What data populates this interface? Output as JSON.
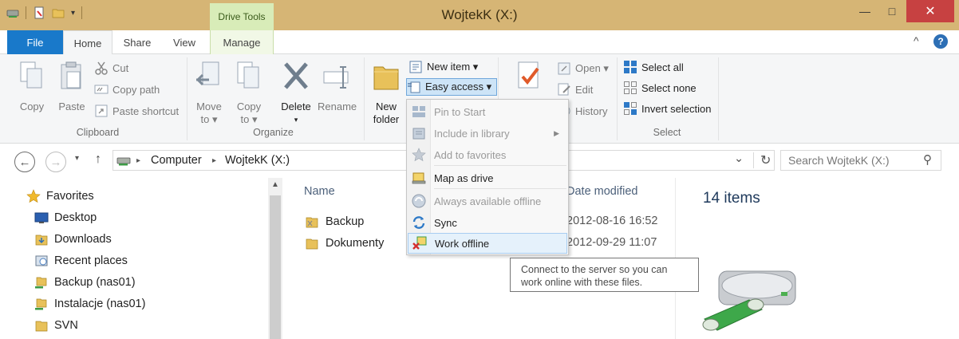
{
  "window": {
    "title": "WojtekK (X:)",
    "context_tab_title": "Drive Tools",
    "controls": {
      "minimize": "—",
      "maximize": "□",
      "close": "✕"
    }
  },
  "tabs": {
    "file": "File",
    "home": "Home",
    "share": "Share",
    "view": "View",
    "manage": "Manage",
    "collapse_glyph": "^",
    "help_glyph": "?"
  },
  "ribbon": {
    "clipboard": {
      "label": "Clipboard",
      "copy": "Copy",
      "paste": "Paste",
      "cut": "Cut",
      "copy_path": "Copy path",
      "paste_shortcut": "Paste shortcut"
    },
    "organize": {
      "label": "Organize",
      "move_to": "Move to",
      "copy_to": "Copy to",
      "delete": "Delete",
      "rename": "Rename",
      "move_to_line1": "Move",
      "move_to_line2": "to ▾",
      "copy_to_line1": "Copy",
      "copy_to_line2": "to ▾",
      "delete_arrow": "▾"
    },
    "new": {
      "new_folder_line1": "New",
      "new_folder_line2": "folder",
      "new_item": "New item ▾",
      "easy_access": "Easy access ▾"
    },
    "open": {
      "open": "Open ▾",
      "edit": "Edit",
      "history": "History"
    },
    "select": {
      "label": "Select",
      "select_all": "Select all",
      "select_none": "Select none",
      "invert_selection": "Invert selection"
    }
  },
  "address": {
    "back_glyph": "←",
    "forward_glyph": "→",
    "recent_glyph": "▾",
    "up_glyph": "↑",
    "crumb_sep": "▸",
    "crumbs": [
      "Computer",
      "WojtekK (X:)"
    ],
    "dropdown_glyph": "⌄",
    "refresh_glyph": "↻",
    "search_placeholder": "Search WojtekK (X:)",
    "search_glyph": "⚲"
  },
  "nav_pane": {
    "favorites": "Favorites",
    "items": [
      "Desktop",
      "Downloads",
      "Recent places",
      "Backup (nas01)",
      "Instalacje (nas01)",
      "SVN"
    ]
  },
  "file_list": {
    "columns": {
      "name": "Name",
      "date_modified": "Date modified"
    },
    "rows": [
      {
        "name": "Backup",
        "date": "2012-08-16 16:52"
      },
      {
        "name": "Dokumenty",
        "date": "2012-09-29 11:07"
      }
    ]
  },
  "details": {
    "count": "14 items"
  },
  "easy_access_menu": {
    "items": [
      {
        "label": "Pin to Start",
        "enabled": false
      },
      {
        "label": "Include in library",
        "enabled": false
      },
      {
        "label": "Add to favorites",
        "enabled": false
      },
      {
        "label": "Map as drive",
        "enabled": true
      },
      {
        "label": "Always available offline",
        "enabled": false
      },
      {
        "label": "Sync",
        "enabled": true
      },
      {
        "label": "Work offline",
        "enabled": true
      }
    ],
    "submenu_arrow": "▶"
  },
  "tooltip": {
    "line1": "Connect to the server so you can",
    "line2": "work online with these files."
  },
  "colors": {
    "titlebar": "#d6b575",
    "file_tab": "#1979ca",
    "context_tab": "#d8ecb8",
    "close_button": "#c74141",
    "selection_blue": "#cde4f7"
  }
}
